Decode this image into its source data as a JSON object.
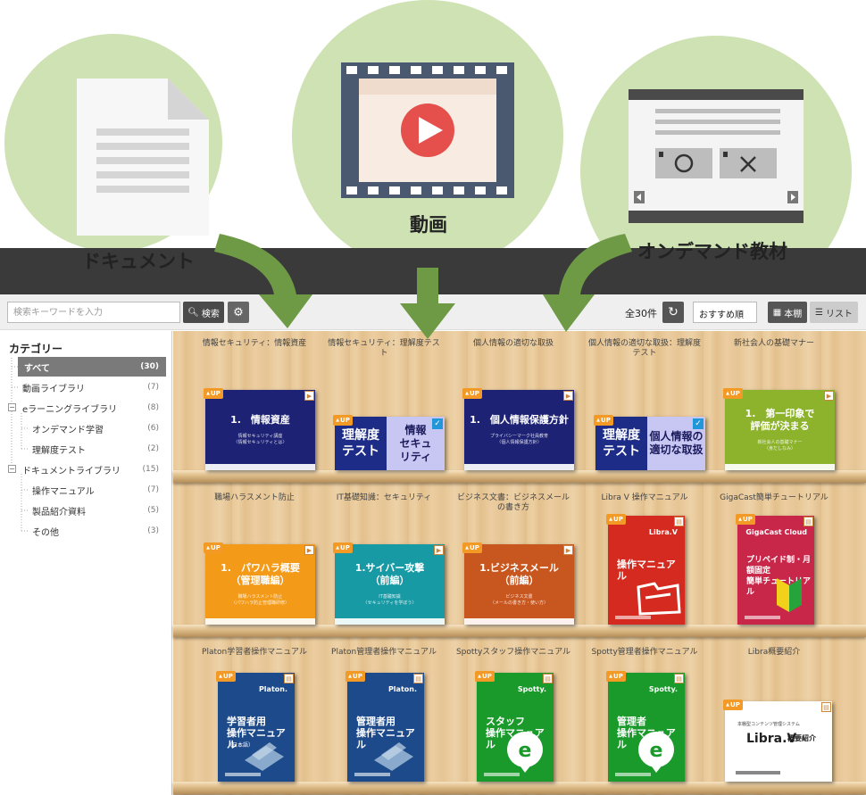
{
  "hero": {
    "document_label": "ドキュメント",
    "video_label": "動画",
    "ondemand_label": "オンデマンド教材"
  },
  "toolbar": {
    "search_placeholder": "検索キーワードを入力",
    "search_button": "検索",
    "total": "全30件",
    "sort": "おすすめ順",
    "view_shelf": "本棚",
    "view_list": "リスト"
  },
  "sidebar": {
    "title": "カテゴリー",
    "items": [
      {
        "label": "すべて",
        "count": "(30)"
      },
      {
        "label": "動画ライブラリ",
        "count": "(7)"
      },
      {
        "label": "eラーニングライブラリ",
        "count": "(8)"
      },
      {
        "label": "オンデマンド学習",
        "count": "(6)"
      },
      {
        "label": "理解度テスト",
        "count": "(2)"
      },
      {
        "label": "ドキュメントライブラリ",
        "count": "(15)"
      },
      {
        "label": "操作マニュアル",
        "count": "(7)"
      },
      {
        "label": "製品紹介資料",
        "count": "(5)"
      },
      {
        "label": "その他",
        "count": "(3)"
      }
    ]
  },
  "shelf": {
    "up": "UP",
    "rows": [
      [
        {
          "title": "情報セキュリティ：情報資産",
          "cover_title": "1.　情報資産",
          "cover_sub": "情報セキュリティ講座\n〈情報セキュリティとは〉",
          "color": "#1d2275"
        },
        {
          "title": "情報セキュリティ：理解度テスト",
          "cover_left": "理解度\nテスト",
          "cover_right": "情報\nセキュ\nリティ"
        },
        {
          "title": "個人情報の適切な取扱",
          "cover_title": "1.　個人情報保護方針",
          "cover_sub": "プライバシーマーク社員教育\n〈個人情報保護方針〉",
          "color": "#1d2275"
        },
        {
          "title": "個人情報の適切な取扱：理解度テスト",
          "cover_left": "理解度\nテスト",
          "cover_right": "個人情報の\n適切な取扱"
        },
        {
          "title": "新社会人の基礎マナー",
          "cover_title": "1.　第一印象で\n評価が決まる",
          "cover_sub": "新社会人の基礎マナー\n〈身だしなみ〉",
          "color": "#8db32c"
        }
      ],
      [
        {
          "title": "職場ハラスメント防止",
          "cover_title": "1.　パワハラ概要\n（管理職編）",
          "cover_sub": "職場ハラスメント防止\n〈パワハラ防止管理職研修〉",
          "color": "#f39a18"
        },
        {
          "title": "IT基礎知識：セキュリティ",
          "cover_title": "1.サイバー攻撃\n（前編）",
          "cover_sub": "IT基礎知識\n〈セキュリティを学ぼう〉",
          "color": "#189aa5"
        },
        {
          "title": "ビジネス文書：ビジネスメールの書き方",
          "cover_title": "1.ビジネスメール\n（前編）",
          "cover_sub": "ビジネス文書\n〈メールの書き方・使い方〉",
          "color": "#c8561f"
        },
        {
          "title": "Libra V 操作マニュアル",
          "brand": "Libra.V",
          "cover_title": "操作マニュアル",
          "color": "#d42a1f"
        },
        {
          "title": "GigaCast簡単チュートリアル",
          "brand": "GigaCast Cloud",
          "cover_title": "プリペイド制・月額固定\n簡単チュートリアル",
          "color": "#c8274a"
        }
      ],
      [
        {
          "title": "Platon学習者操作マニュアル",
          "brand": "Platon.",
          "cover_title": "学習者用\n操作マニュアル",
          "cover_sub": "（日本語）",
          "color": "#1d4a8a"
        },
        {
          "title": "Platon管理者操作マニュアル",
          "brand": "Platon.",
          "cover_title": "管理者用\n操作マニュアル",
          "color": "#1d4a8a"
        },
        {
          "title": "Spottyスタッフ操作マニュアル",
          "brand": "Spotty.",
          "cover_title": "スタッフ\n操作マニュアル",
          "color": "#1b9a2c"
        },
        {
          "title": "Spotty管理者操作マニュアル",
          "brand": "Spotty.",
          "cover_title": "管理者\n操作マニュアル",
          "color": "#1b9a2c"
        },
        {
          "title": "Libra概要紹介",
          "brand": "Libra.V",
          "cover_title": "概要紹介",
          "cover_sub": "本棚型コンテンツ管理システム",
          "color": "#ffffff"
        }
      ]
    ]
  }
}
